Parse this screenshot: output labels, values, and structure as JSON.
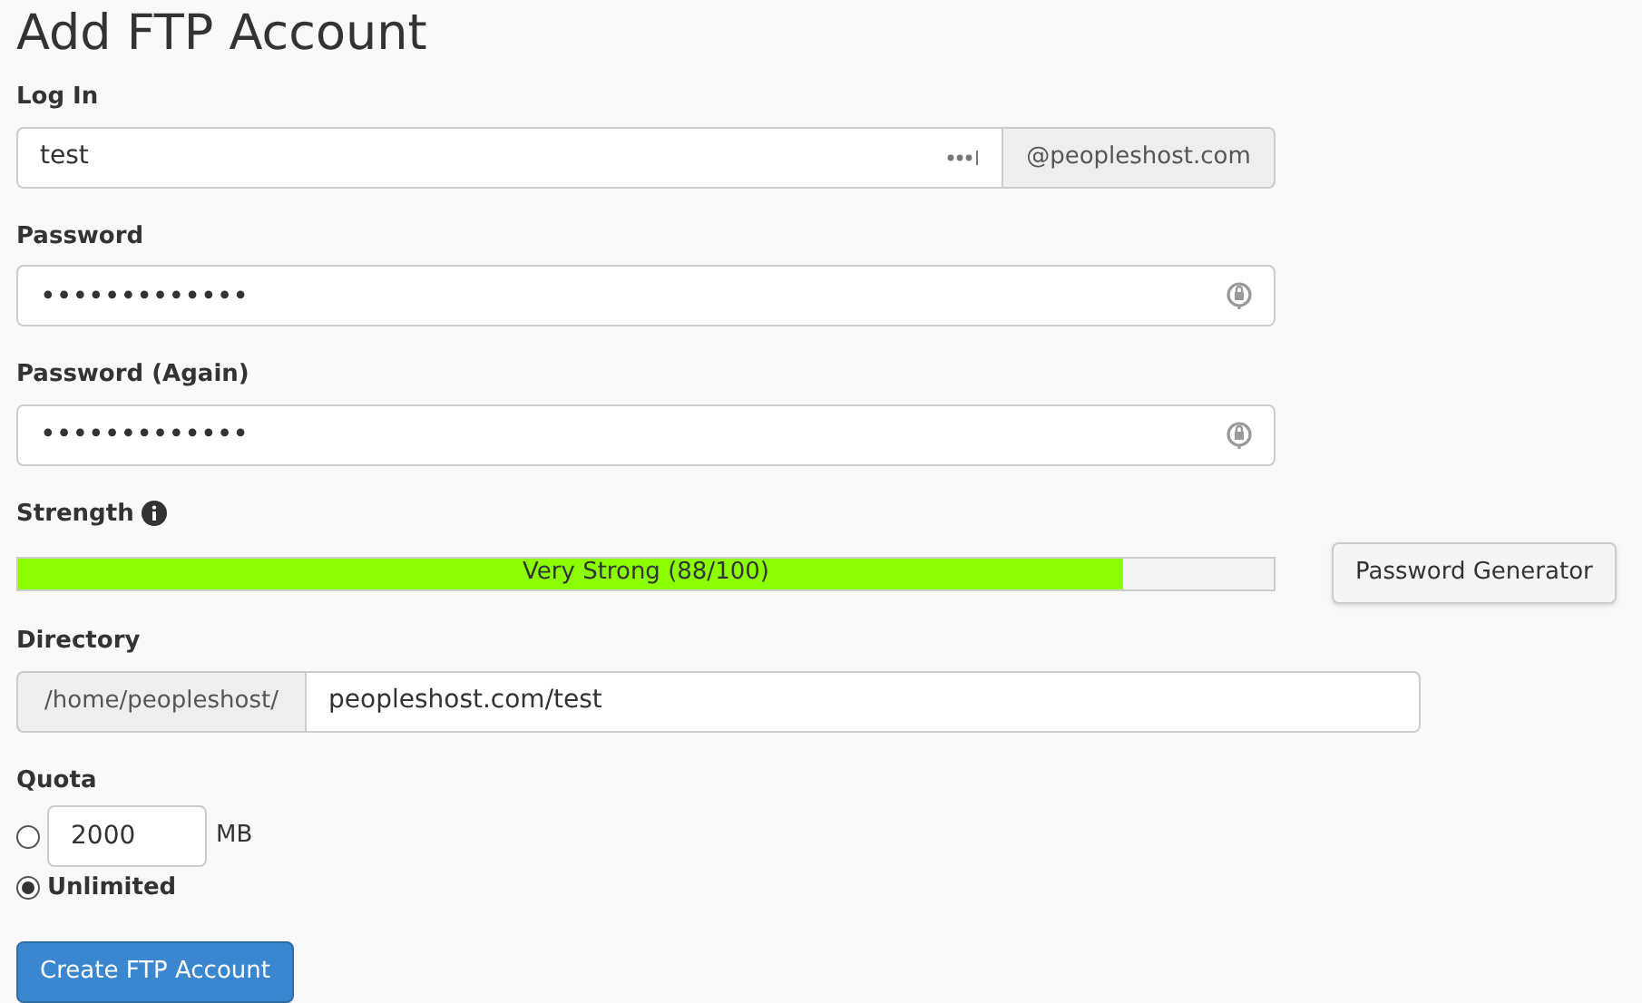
{
  "title": "Add FTP Account",
  "login": {
    "label": "Log In",
    "value": "test",
    "domain": "@peopleshost.com"
  },
  "password": {
    "label": "Password",
    "value": "•••••••••••••"
  },
  "password_again": {
    "label": "Password (Again)",
    "value": "•••••••••••••"
  },
  "strength": {
    "label": "Strength",
    "level": 0.88,
    "reading": "Very Strong (88/100)",
    "generator_button": "Password Generator"
  },
  "directory": {
    "label": "Directory",
    "prefix": "/home/peopleshost/",
    "value": "peopleshost.com/test"
  },
  "quota": {
    "label": "Quota",
    "options": [
      {
        "kind": "amount",
        "value": "2000",
        "unit": "MB",
        "selected": false
      },
      {
        "kind": "unlimited",
        "label": "Unlimited",
        "selected": true
      }
    ]
  },
  "submit_button": "Create FTP Account"
}
